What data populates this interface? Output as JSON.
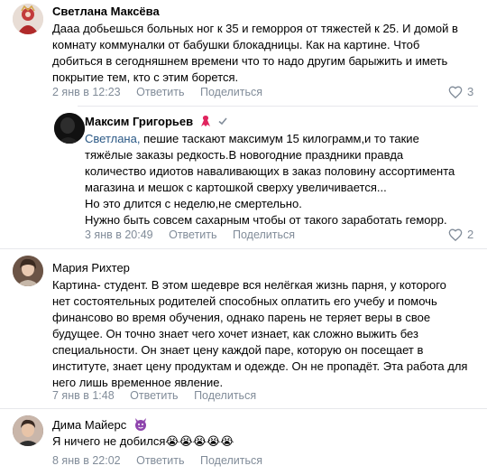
{
  "comments": [
    {
      "author": "Светлана Максёва",
      "lines": [
        "Дааа добьешься больных ног к 35 и геморроя от тяжестей к 25. И домой в",
        "комнату коммуналки от бабушки блокадницы. Как на картине. Чтоб",
        "добиться в сегодняшнем времени что то надо другим барыжить и иметь",
        "покрытие тем, кто с этим борется."
      ],
      "date": "2 янв в 12:23",
      "reply": "Ответить",
      "share": "Поделиться",
      "likes": "3"
    },
    {
      "author": "Максим Григорьев",
      "mention": "Светлана,",
      "lines": [
        " пешие таскают максимум 15 килограмм,и то такие",
        "тяжёлые заказы редкость.В новогодние праздники правда",
        "количество идиотов наваливающих в заказ половину ассортимента",
        "магазина и мешок с картошкой сверху увеличивается...",
        "Но это длится с неделю,не смертельно.",
        "Нужно быть совсем сахарным чтобы от такого заработать геморр."
      ],
      "date": "3 янв в 20:49",
      "reply": "Ответить",
      "share": "Поделиться",
      "likes": "2"
    },
    {
      "author": "Мария Рихтер",
      "lines": [
        "Картина- студент. В этом шедевре вся нелёгкая жизнь парня, у которого",
        "нет состоятельных родителей способных оплатить его учебу и помочь",
        "финансово во время обучения, однако парень не теряет веры в свое",
        "будущее. Он точно знает чего хочет изнает, как сложно выжить без",
        "специальности. Он знает цену каждой паре, которую он посещает в",
        "институте, знает цену продуктам и одежде. Он не пропадёт. Эта работа для",
        "него лишь временное явление."
      ],
      "date": "7 янв в 1:48",
      "reply": "Ответить",
      "share": "Поделиться"
    },
    {
      "author": "Дима Майерс",
      "lines": [
        "Я ничего не добился😭😭😭😭😭"
      ],
      "date": "8 янв в 22:02",
      "reply": "Ответить",
      "share": "Поделиться"
    }
  ],
  "colors": {
    "name": "#000000",
    "meta": "#818c99",
    "mention": "#2a5885",
    "divider": "#e7e8ec"
  }
}
